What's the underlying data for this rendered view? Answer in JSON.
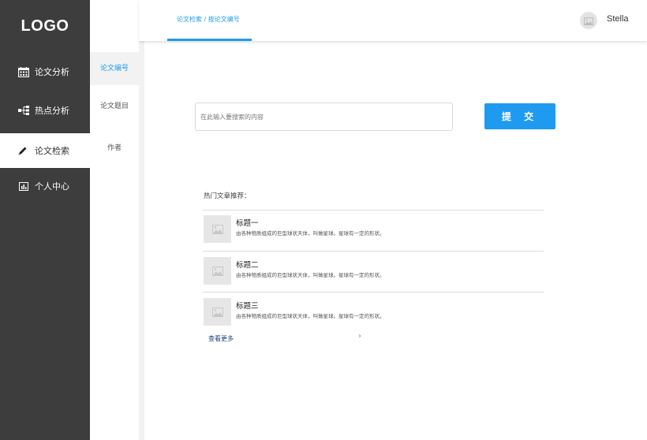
{
  "sidebar": {
    "logo": "LOGO",
    "items": [
      {
        "label": "论文分析",
        "icon": "calendar-icon"
      },
      {
        "label": "热点分析",
        "icon": "hierarchy-icon"
      },
      {
        "label": "论文检索",
        "icon": "pencil-icon"
      },
      {
        "label": "个人中心",
        "icon": "chart-icon"
      }
    ]
  },
  "submenu": {
    "items": [
      {
        "label": "论文编号"
      },
      {
        "label": "论文题目"
      },
      {
        "label": "作者"
      }
    ]
  },
  "header": {
    "breadcrumb": "论文检索 / 按论文编号",
    "username": "Stella"
  },
  "search": {
    "placeholder": "在此输入要搜索的内容",
    "submit_label": "提 交"
  },
  "hot": {
    "title": "热门文章推荐：",
    "articles": [
      {
        "title": "标题一",
        "desc": "由各种物质组成的巨型球状天体，叫做星球。星球有一定的形状。"
      },
      {
        "title": "标题二",
        "desc": "由各种物质组成的巨型球状天体，叫做星球。星球有一定的形状。"
      },
      {
        "title": "标题三",
        "desc": "由各种物质组成的巨型球状天体，叫做星球。星球有一定的形状。"
      }
    ],
    "more_label": "查看更多",
    "more_arrow": "›"
  },
  "colors": {
    "accent": "#1e9bf0",
    "sidebar_bg": "#3d3d3d"
  }
}
